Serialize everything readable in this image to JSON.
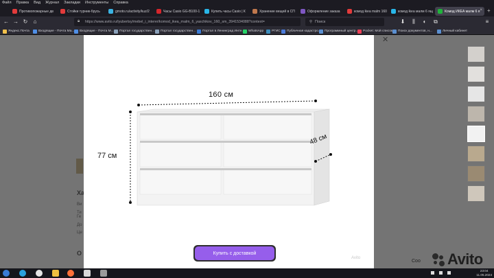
{
  "menu": [
    "Файл",
    "Правка",
    "Вид",
    "Журнал",
    "Закладки",
    "Инструменты",
    "Справка"
  ],
  "tabs": [
    {
      "label": "Противопожарные дв",
      "color": "#e23b3b",
      "active": false
    },
    {
      "label": "Стойки турник-брусь",
      "color": "#e23b3b",
      "active": false
    },
    {
      "label": "gmoto.ru/activity/kuz/2",
      "color": "#3bb3e2",
      "active": false
    },
    {
      "label": "Часы Casio GG-B100-1",
      "color": "#d6262c",
      "active": false
    },
    {
      "label": "Купить часы Casio | К",
      "color": "#29b6e8",
      "active": false
    },
    {
      "label": "Хранение вещей в СП",
      "color": "#c0784d",
      "active": false
    },
    {
      "label": "Оформление заказа",
      "color": "#7e57c2",
      "active": false
    },
    {
      "label": "комод ikea malm 160",
      "color": "#e23b3b",
      "active": false
    },
    {
      "label": "комод ikea малм 6 ящ",
      "color": "#29b6e8",
      "active": false
    },
    {
      "label": "Комод ИКЕА малм 6 я",
      "color": "#1fb43b",
      "active": true
    }
  ],
  "nav": {
    "url": "https://www.avito.ru/lyubertsy/mebel_i_interer/komod_ikea_malm_6_yaschikov_160_sm_3941534088?context=",
    "search_placeholder": "Поиск"
  },
  "bookmarks": [
    "Яндекс.Почта",
    "Входящие - Почта Ма...",
    "Входящие - Почта М...",
    "Портал государствен...",
    "Портал государствен...",
    "Портал в Ленинград Инте...",
    "WhatsApp",
    "РГИС",
    "Публичная кадастро...",
    "Программный центр...",
    "Pocket: Мой список",
    "Поиск документов, н...",
    "Личный кабинет"
  ],
  "modal": {
    "dim_width": "160 см",
    "dim_height": "77 см",
    "dim_depth": "48 см",
    "buy_button": "Купить с доставкой",
    "watermark": "Avito"
  },
  "background": {
    "left_heading": "Ха",
    "left_lines": [
      "Ви",
      "Ти",
      "Ге",
      "До",
      "Це"
    ],
    "left_bottom": "О",
    "avito_logo": "Avito",
    "right_label": "Coo"
  },
  "taskbar": {
    "time": "23:04",
    "date": "11.05.2024"
  },
  "colors": {
    "accent_button": "#965eeb",
    "overlay": "#747474"
  }
}
